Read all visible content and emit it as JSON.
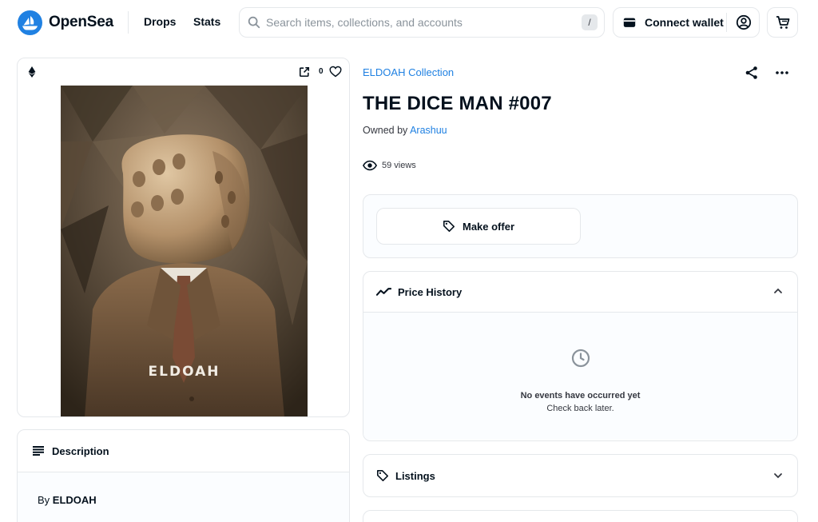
{
  "header": {
    "brand": "OpenSea",
    "nav": {
      "drops": "Drops",
      "stats": "Stats"
    },
    "search": {
      "placeholder": "Search items, collections, and accounts",
      "shortcut": "/"
    },
    "wallet_label": "Connect wallet"
  },
  "asset": {
    "favorites": "0",
    "art_text": "ELDOAH",
    "collection": "ELDOAH Collection",
    "title": "THE DICE MAN #007",
    "owned_prefix": "Owned by",
    "owner": "Arashuu",
    "views": "59 views"
  },
  "description": {
    "title": "Description",
    "by_prefix": "By",
    "author": "ELDOAH"
  },
  "offer": {
    "label": "Make offer"
  },
  "price_history": {
    "title": "Price History",
    "expanded": true,
    "empty_title": "No events have occurred yet",
    "empty_sub": "Check back later."
  },
  "listings": {
    "title": "Listings",
    "expanded": false
  },
  "icons": {
    "logo": "opensea-logo-icon",
    "search": "search-icon",
    "wallet": "wallet-icon",
    "profile": "profile-icon",
    "cart": "cart-icon",
    "chain": "ethereum-icon",
    "open": "open-external-icon",
    "favorite": "heart-icon",
    "share": "share-icon",
    "more": "more-icon",
    "views": "eye-icon",
    "offer": "tag-icon",
    "price_history": "trend-line-icon",
    "clock": "clock-icon",
    "listings": "tag-icon",
    "description": "list-icon"
  },
  "colors": {
    "accent": "#2081e2",
    "text": "#04111d",
    "border": "#e5e8eb"
  }
}
